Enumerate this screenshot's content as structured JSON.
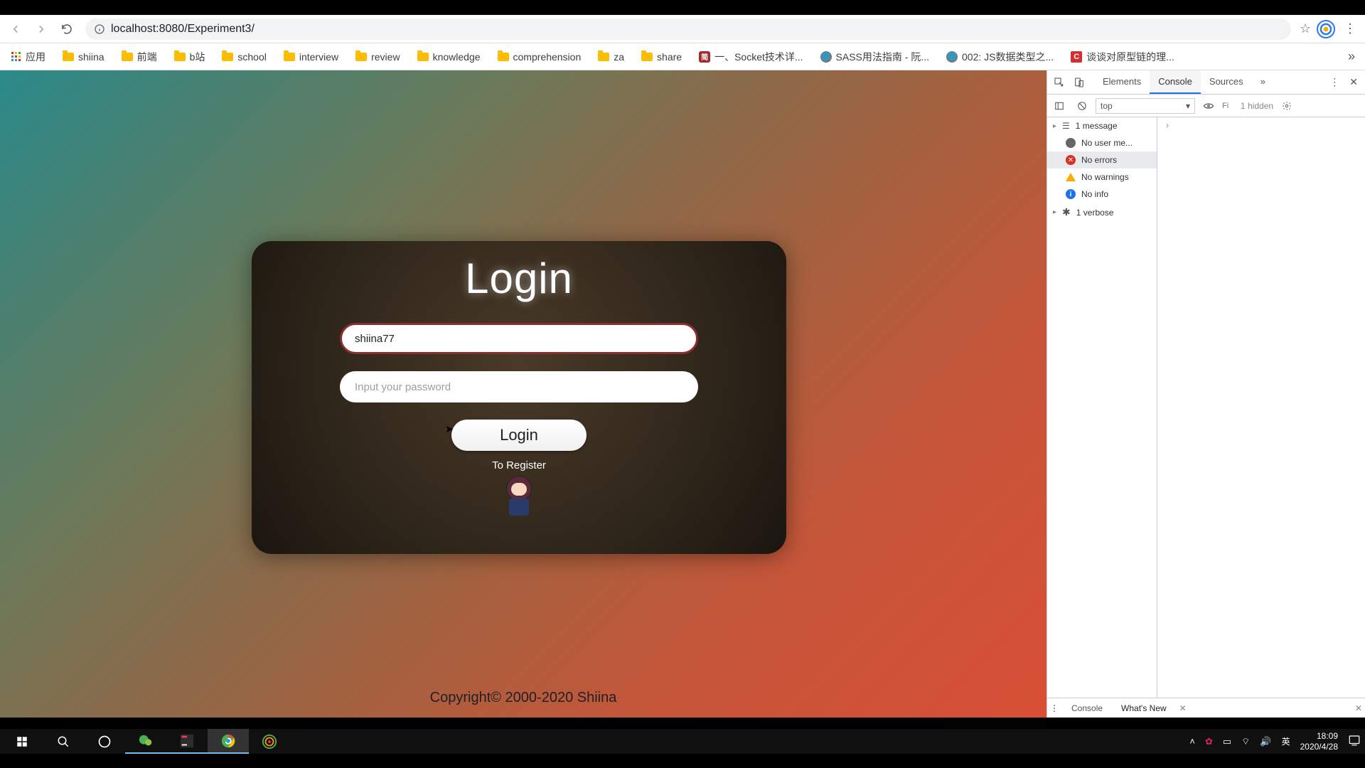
{
  "browser": {
    "url": "localhost:8080/Experiment3/",
    "apps_label": "应用"
  },
  "bookmarks": [
    {
      "type": "folder",
      "label": "shiina"
    },
    {
      "type": "folder",
      "label": "前端"
    },
    {
      "type": "folder",
      "label": "b站"
    },
    {
      "type": "folder",
      "label": "school"
    },
    {
      "type": "folder",
      "label": "interview"
    },
    {
      "type": "folder",
      "label": "review"
    },
    {
      "type": "folder",
      "label": "knowledge"
    },
    {
      "type": "folder",
      "label": "comprehension"
    },
    {
      "type": "folder",
      "label": "za"
    },
    {
      "type": "folder",
      "label": "share"
    },
    {
      "type": "red",
      "label": "一、Socket技术详..."
    },
    {
      "type": "globe",
      "label": "SASS用法指南 - 阮..."
    },
    {
      "type": "globe",
      "label": "002: JS数据类型之..."
    },
    {
      "type": "c",
      "label": "谈谈对原型链的理..."
    }
  ],
  "login": {
    "title": "Login",
    "username_value": "shiina77",
    "password_placeholder": "Input your password",
    "button_label": "Login",
    "register_label": "To Register"
  },
  "footer": "Copyright© 2000-2020 Shiina",
  "devtools": {
    "tabs": {
      "elements": "Elements",
      "console": "Console",
      "sources": "Sources"
    },
    "context": "top",
    "filter_placeholder": "Fi",
    "hidden": "1 hidden",
    "groups": {
      "messages": "1 message",
      "user": "No user me...",
      "errors": "No errors",
      "warnings": "No warnings",
      "info": "No info",
      "verbose": "1 verbose"
    },
    "drawer": {
      "console": "Console",
      "whatsnew": "What's New"
    }
  },
  "taskbar": {
    "ime_mode": "英",
    "time": "18:09",
    "date": "2020/4/28"
  }
}
